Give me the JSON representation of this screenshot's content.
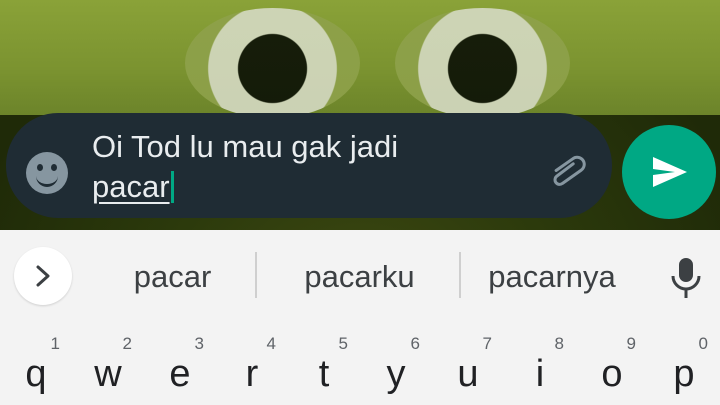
{
  "colors": {
    "message_bar_bg": "#1f2c34",
    "accent": "#00a884",
    "message_text": "#e9edef",
    "keyboard_bg": "#f3f3f3"
  },
  "composer": {
    "text_line1": "Oi Tod lu mau gak jadi",
    "text_composing": "pacar",
    "emoji_icon": "smiley-icon",
    "attach_icon": "paperclip-icon",
    "send_icon": "send-arrow-icon"
  },
  "keyboard": {
    "expand_icon": "chevron-right-icon",
    "suggestions": [
      "pacar",
      "pacarku",
      "pacarnya"
    ],
    "mic_icon": "microphone-icon",
    "keys": [
      {
        "char": "q",
        "hint": "1"
      },
      {
        "char": "w",
        "hint": "2"
      },
      {
        "char": "e",
        "hint": "3"
      },
      {
        "char": "r",
        "hint": "4"
      },
      {
        "char": "t",
        "hint": "5"
      },
      {
        "char": "y",
        "hint": "6"
      },
      {
        "char": "u",
        "hint": "7"
      },
      {
        "char": "i",
        "hint": "8"
      },
      {
        "char": "o",
        "hint": "9"
      },
      {
        "char": "p",
        "hint": "0"
      }
    ]
  }
}
